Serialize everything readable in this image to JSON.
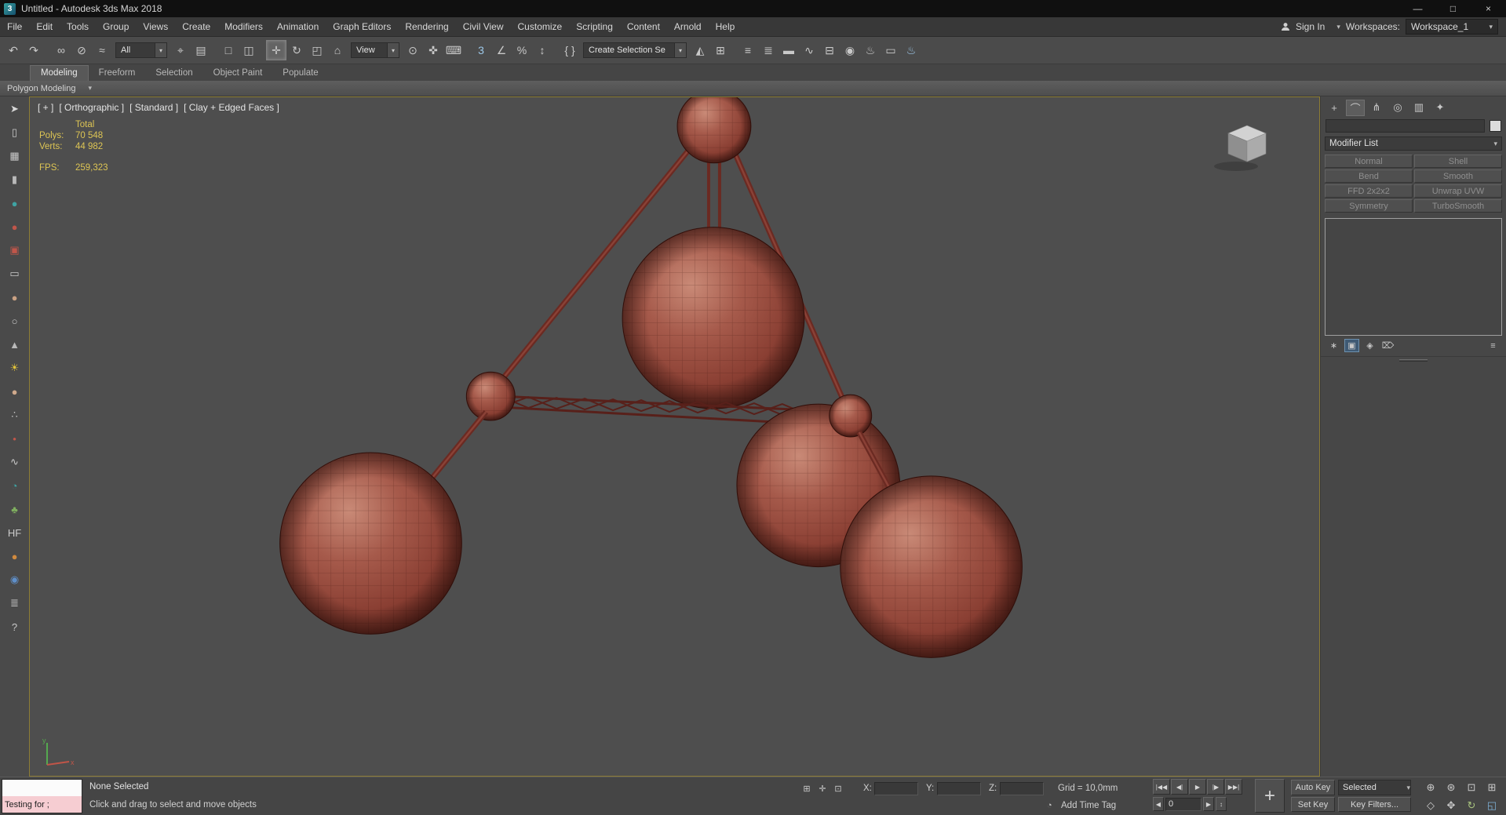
{
  "colors": {
    "viewport_border": "#8d7d35",
    "stats_text": "#ddc554",
    "sphere_base": "#a65a4b",
    "listener_pink": "#f6cdd2"
  },
  "titlebar": {
    "app_icon_label": "3",
    "title": "Untitled - Autodesk 3ds Max 2018",
    "minimize_glyph": "—",
    "maximize_glyph": "□",
    "close_glyph": "×"
  },
  "menubar": {
    "items": [
      {
        "name": "menu-file",
        "label": "File"
      },
      {
        "name": "menu-edit",
        "label": "Edit"
      },
      {
        "name": "menu-tools",
        "label": "Tools"
      },
      {
        "name": "menu-group",
        "label": "Group"
      },
      {
        "name": "menu-views",
        "label": "Views"
      },
      {
        "name": "menu-create",
        "label": "Create"
      },
      {
        "name": "menu-modifiers",
        "label": "Modifiers"
      },
      {
        "name": "menu-animation",
        "label": "Animation"
      },
      {
        "name": "menu-graph-editors",
        "label": "Graph Editors"
      },
      {
        "name": "menu-rendering",
        "label": "Rendering"
      },
      {
        "name": "menu-civil-view",
        "label": "Civil View"
      },
      {
        "name": "menu-customize",
        "label": "Customize"
      },
      {
        "name": "menu-scripting",
        "label": "Scripting"
      },
      {
        "name": "menu-content",
        "label": "Content"
      },
      {
        "name": "menu-arnold",
        "label": "Arnold"
      },
      {
        "name": "menu-help",
        "label": "Help"
      }
    ],
    "sign_in_label": "Sign In",
    "workspaces_label": "Workspaces:",
    "workspace_value": "Workspace_1"
  },
  "toolbar": {
    "strip1": [
      {
        "name": "undo-icon",
        "glyph": "↶"
      },
      {
        "name": "redo-icon",
        "glyph": "↷"
      },
      {
        "name": "separator",
        "glyph": "",
        "cls": "sep",
        "interactable": false
      },
      {
        "name": "select-and-link-icon",
        "glyph": "∞"
      },
      {
        "name": "unlink-selection-icon",
        "glyph": "⊘"
      },
      {
        "name": "bind-to-space-warp-icon",
        "glyph": "≈"
      }
    ],
    "filter_value": "All",
    "strip2": [
      {
        "name": "select-object-icon",
        "glyph": "⌖"
      },
      {
        "name": "select-by-name-icon",
        "glyph": "▤"
      },
      {
        "name": "separator",
        "glyph": "",
        "cls": "sep",
        "interactable": false
      },
      {
        "name": "rectangular-selection-region-icon",
        "glyph": "□"
      },
      {
        "name": "window-crossing-toggle-icon",
        "glyph": "◫"
      },
      {
        "name": "separator",
        "glyph": "",
        "cls": "sep",
        "interactable": false
      },
      {
        "name": "select-and-move-icon",
        "glyph": "✛",
        "active": true
      },
      {
        "name": "select-and-rotate-icon",
        "glyph": "↻"
      },
      {
        "name": "select-and-scale-icon",
        "glyph": "◰"
      },
      {
        "name": "select-and-place-icon",
        "glyph": "⌂"
      }
    ],
    "coord_value": "View",
    "strip3": [
      {
        "name": "use-pivot-point-center-icon",
        "glyph": "⊙"
      },
      {
        "name": "select-and-manipulate-icon",
        "glyph": "✜"
      },
      {
        "name": "keyboard-shortcut-override-icon",
        "glyph": "⌨"
      },
      {
        "name": "separator",
        "glyph": "",
        "cls": "sep",
        "interactable": false
      },
      {
        "name": "snaps-toggle-icon",
        "glyph": "3",
        "color": "#9cc7e8"
      },
      {
        "name": "angle-snap-toggle-icon",
        "glyph": "∠"
      },
      {
        "name": "percent-snap-toggle-icon",
        "glyph": "%"
      },
      {
        "name": "spinner-snap-toggle-icon",
        "glyph": "↕"
      },
      {
        "name": "separator",
        "glyph": "",
        "cls": "sep",
        "interactable": false
      },
      {
        "name": "edit-named-selection-sets-icon",
        "glyph": "{ }"
      }
    ],
    "named_set_value": "Create Selection Se",
    "strip4": [
      {
        "name": "mirror-icon",
        "glyph": "◭"
      },
      {
        "name": "align-icon",
        "glyph": "⊞"
      },
      {
        "name": "separator",
        "glyph": "",
        "cls": "sep",
        "interactable": false
      },
      {
        "name": "toggle-scene-explorer-icon",
        "glyph": "≡"
      },
      {
        "name": "toggle-layer-explorer-icon",
        "glyph": "≣"
      },
      {
        "name": "toggle-ribbon-icon",
        "glyph": "▬"
      },
      {
        "name": "curve-editor-icon",
        "glyph": "∿"
      },
      {
        "name": "schematic-view-icon",
        "glyph": "⊟"
      },
      {
        "name": "material-editor-icon",
        "glyph": "◉"
      },
      {
        "name": "render-setup-icon",
        "glyph": "♨"
      },
      {
        "name": "rendered-frame-window-icon",
        "glyph": "▭"
      },
      {
        "name": "render-production-icon",
        "glyph": "♨",
        "color": "#9cc7e8"
      }
    ]
  },
  "ribbon": {
    "tabs": [
      {
        "name": "tab-modeling",
        "label": "Modeling",
        "active": true
      },
      {
        "name": "tab-freeform",
        "label": "Freeform"
      },
      {
        "name": "tab-selection",
        "label": "Selection"
      },
      {
        "name": "tab-object-paint",
        "label": "Object Paint"
      },
      {
        "name": "tab-populate",
        "label": "Populate"
      }
    ],
    "config_glyph": "◉",
    "section_label": "Polygon Modeling"
  },
  "left_toolbar": {
    "icons": [
      {
        "name": "select-arrow-icon",
        "glyph": "➤",
        "color": "#d8d8d8"
      },
      {
        "name": "document-icon",
        "glyph": "▯",
        "color": "#c9c9c9"
      },
      {
        "name": "spreadsheet-icon",
        "glyph": "▦",
        "color": "#c9c9c9"
      },
      {
        "name": "cylinder-icon",
        "glyph": "▮",
        "color": "#b9b9b9"
      },
      {
        "name": "sphere-teal-icon",
        "glyph": "●",
        "color": "#3fa3a3"
      },
      {
        "name": "sphere-red-icon",
        "glyph": "●",
        "color": "#c0564a"
      },
      {
        "name": "camera-icon",
        "glyph": "▣",
        "color": "#c0564a"
      },
      {
        "name": "box-icon",
        "glyph": "▭",
        "color": "#c9c9c9"
      },
      {
        "name": "sphere-tan-icon",
        "glyph": "●",
        "color": "#c9a183"
      },
      {
        "name": "circle-icon",
        "glyph": "○",
        "color": "#c9c9c9"
      },
      {
        "name": "cone-icon",
        "glyph": "▲",
        "color": "#b9b9b9"
      },
      {
        "name": "sun-icon",
        "glyph": "☀",
        "color": "#e3c43a"
      },
      {
        "name": "sphere-beige-icon",
        "glyph": "●",
        "color": "#cfa98c"
      },
      {
        "name": "scatter-icon",
        "glyph": "∴",
        "color": "#c9c9c9"
      },
      {
        "name": "small-sphere-icon",
        "glyph": "•",
        "color": "#c0564a"
      },
      {
        "name": "spline-icon",
        "glyph": "∿",
        "color": "#c9c9c9"
      },
      {
        "name": "swirl-icon",
        "glyph": "◔",
        "color": "#3fa3a3"
      },
      {
        "name": "plant-icon",
        "glyph": "♣",
        "color": "#7fae5f"
      },
      {
        "name": "hf-icon",
        "glyph": "HF",
        "color": "#cccccc"
      },
      {
        "name": "sphere-orange-icon",
        "glyph": "●",
        "color": "#d08a3f"
      },
      {
        "name": "sphere-blue-icon",
        "glyph": "◉",
        "color": "#5f8fc9"
      },
      {
        "name": "layers-icon",
        "glyph": "≣",
        "color": "#c9c9c9"
      },
      {
        "name": "help-icon",
        "glyph": "?",
        "color": "#c9c9c9"
      }
    ]
  },
  "viewport": {
    "label_general": "[ + ]",
    "label_pov": "[ Orthographic ]",
    "label_standard": "[ Standard ]",
    "label_shading": "[ Clay + Edged Faces ]",
    "stats": {
      "total_label": "Total",
      "polys_label": "Polys:",
      "polys_value": "70 548",
      "verts_label": "Verts:",
      "verts_value": "44 982",
      "fps_label": "FPS:",
      "fps_value": "259,323"
    }
  },
  "command_panel": {
    "tabs": [
      {
        "name": "create-tab",
        "glyph": "+"
      },
      {
        "name": "modify-tab",
        "glyph": "⌒",
        "active": true
      },
      {
        "name": "hierarchy-tab",
        "glyph": "⋔"
      },
      {
        "name": "motion-tab",
        "glyph": "◎"
      },
      {
        "name": "display-tab",
        "glyph": "▥"
      },
      {
        "name": "utilities-tab",
        "glyph": "✦"
      }
    ],
    "modifier_list_label": "Modifier List",
    "modifier_buttons": [
      {
        "name": "normal-modifier-button",
        "label": "Normal"
      },
      {
        "name": "shell-modifier-button",
        "label": "Shell"
      },
      {
        "name": "bend-modifier-button",
        "label": "Bend"
      },
      {
        "name": "smooth-modifier-button",
        "label": "Smooth"
      },
      {
        "name": "ffd-2x2x2-modifier-button",
        "label": "FFD 2x2x2"
      },
      {
        "name": "unwrap-uvw-modifier-button",
        "label": "Unwrap UVW"
      },
      {
        "name": "symmetry-modifier-button",
        "label": "Symmetry"
      },
      {
        "name": "turbosmooth-modifier-button",
        "label": "TurboSmooth"
      }
    ],
    "stack_tools": [
      {
        "name": "pin-stack-icon",
        "glyph": "∗"
      },
      {
        "name": "show-end-result-icon",
        "glyph": "▣",
        "active": true
      },
      {
        "name": "make-unique-icon",
        "glyph": "◈"
      },
      {
        "name": "remove-modifier-icon",
        "glyph": "⌦"
      },
      {
        "name": "configure-modifier-sets-icon",
        "glyph": "≡"
      }
    ]
  },
  "statusbar": {
    "listener_text": "Testing for ;",
    "selection_status": "None Selected",
    "prompt": "Click and drag to select and move objects",
    "mini_icons": [
      {
        "name": "absolute-mode-icon",
        "glyph": "⊞"
      },
      {
        "name": "transform-gizmo-icon",
        "glyph": "✛"
      },
      {
        "name": "selection-lock-icon",
        "glyph": "⊡"
      }
    ],
    "x_label": "X:",
    "y_label": "Y:",
    "z_label": "Z:",
    "grid_label": "Grid = 10,0mm",
    "time_tag_icon": "◔",
    "add_time_tag_label": "Add Time Tag",
    "playback": [
      {
        "name": "go-to-start-icon",
        "glyph": "|◀◀"
      },
      {
        "name": "previous-frame-icon",
        "glyph": "◀|"
      },
      {
        "name": "play-icon",
        "glyph": "▶"
      },
      {
        "name": "next-frame-icon",
        "glyph": "|▶"
      },
      {
        "name": "go-to-end-icon",
        "glyph": "▶▶|"
      }
    ],
    "prev_key_glyph": "◀",
    "next_key_glyph": "▶",
    "frame_value": "0",
    "frame_spinner_glyph": "↕",
    "set_keys_glyph": "+",
    "auto_key_label": "Auto Key",
    "set_key_label": "Set Key",
    "selected_value": "Selected",
    "key_filters_label": "Key Filters...",
    "nav_icons": [
      {
        "name": "zoom-icon",
        "glyph": "⊕"
      },
      {
        "name": "zoom-all-icon",
        "glyph": "⊛"
      },
      {
        "name": "zoom-extents-icon",
        "glyph": "⊡"
      },
      {
        "name": "zoom-extents-all-icon",
        "glyph": "⊞"
      },
      {
        "name": "field-of-view-icon",
        "glyph": "◇"
      },
      {
        "name": "pan-icon",
        "glyph": "✥"
      },
      {
        "name": "orbit-icon",
        "glyph": "↻",
        "color": "#a9c47f"
      },
      {
        "name": "maximize-viewport-toggle-icon",
        "glyph": "◱",
        "color": "#7fb2d8"
      }
    ]
  }
}
